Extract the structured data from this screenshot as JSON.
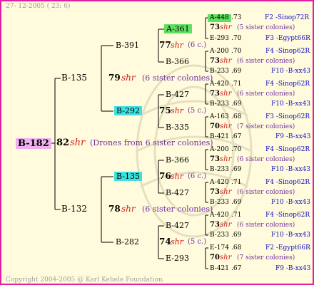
{
  "header": {
    "date": "27- 12-2005 ( 23: 6)"
  },
  "footer": {
    "copyright": "Copyright 2004-2005 @ Karl Kehele Foundation."
  },
  "colors": {
    "border": "#e020a0",
    "background": "#fffbdc",
    "root_highlight": "#f0b0f0",
    "green_highlight": "#60e060",
    "cyan_highlight": "#40e0e0",
    "blue_text": "#1010c8",
    "purple_text": "#7030a0",
    "red_text": "#d02020"
  },
  "root": {
    "id": "B-182",
    "num": "82",
    "shr": "shr",
    "note": "(Drones from 6 sister colonies)"
  },
  "gen1": [
    {
      "id": "B-135",
      "num": "79",
      "shr": "shr",
      "note": "(6 sister colonies)"
    },
    {
      "id": "B-132",
      "num": "78",
      "shr": "shr",
      "note": "(6 sister colonies)"
    }
  ],
  "gen2": [
    {
      "id": "B-391",
      "num": "77",
      "shr": "shr",
      "note": "(6 c.)"
    },
    {
      "id": "B-292",
      "num": "75",
      "shr": "shr",
      "note": "(5 c.)"
    },
    {
      "id": "B-135",
      "num": "76",
      "shr": "shr",
      "note": "(6 c.)"
    },
    {
      "id": "B-282",
      "num": "74",
      "shr": "shr",
      "note": "(5 c.)"
    }
  ],
  "gen3": [
    {
      "id": "A-361",
      "num": "73",
      "shr": "shr",
      "note": "(5 sister colonies)"
    },
    {
      "id": "B-366",
      "num": "73",
      "shr": "shr",
      "note": "(6 sister colonies)"
    },
    {
      "id": "B-427",
      "num": "73",
      "shr": "shr",
      "note": "(6 sister colonies)"
    },
    {
      "id": "B-335",
      "num": "70",
      "shr": "shr",
      "note": "(7 sister colonies)"
    },
    {
      "id": "B-366",
      "num": "73",
      "shr": "shr",
      "note": "(6 sister colonies)"
    },
    {
      "id": "B-427",
      "num": "73",
      "shr": "shr",
      "note": "(6 sister colonies)"
    },
    {
      "id": "B-427",
      "num": "73",
      "shr": "shr",
      "note": "(6 sister colonies)"
    },
    {
      "id": "E-293",
      "num": "70",
      "shr": "shr",
      "note": "(7 sister colonies)"
    }
  ],
  "gen4": [
    {
      "id": "A-448",
      "val": ".73",
      "breed": "F2 -Sinop72R"
    },
    {
      "id": "E-293",
      "val": ".70",
      "breed": "F3 -Egypt66R"
    },
    {
      "id": "A-200",
      "val": ".70",
      "breed": "F4 -Sinop62R"
    },
    {
      "id": "B-233",
      "val": ".69",
      "breed": "F10 -B-xx43"
    },
    {
      "id": "A-420",
      "val": ".71",
      "breed": "F4 -Sinop62R"
    },
    {
      "id": "B-233",
      "val": ".69",
      "breed": "F10 -B-xx43"
    },
    {
      "id": "A-163",
      "val": ".68",
      "breed": "F3 -Sinop62R"
    },
    {
      "id": "B-421",
      "val": ".67",
      "breed": "F9 -B-xx43"
    },
    {
      "id": "A-200",
      "val": ".70",
      "breed": "F4 -Sinop62R"
    },
    {
      "id": "B-233",
      "val": ".69",
      "breed": "F10 -B-xx43"
    },
    {
      "id": "A-420",
      "val": ".71",
      "breed": "F4 -Sinop62R"
    },
    {
      "id": "B-233",
      "val": ".69",
      "breed": "F10 -B-xx43"
    },
    {
      "id": "A-420",
      "val": ".71",
      "breed": "F4 -Sinop62R"
    },
    {
      "id": "B-233",
      "val": ".69",
      "breed": "F10 -B-xx43"
    },
    {
      "id": "E-174",
      "val": ".68",
      "breed": "F2 -Egypt66R"
    },
    {
      "id": "B-421",
      "val": ".67",
      "breed": "F9 -B-xx43"
    }
  ]
}
